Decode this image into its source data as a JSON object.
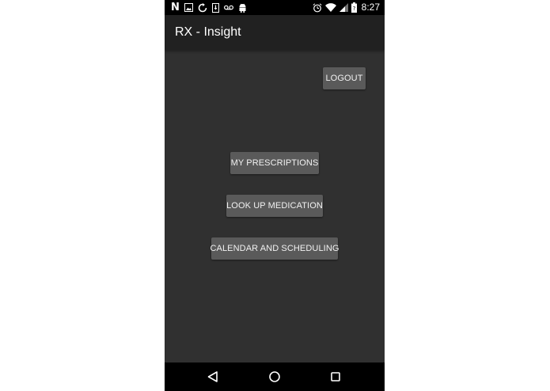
{
  "status_bar": {
    "time": "8:27",
    "left_icons": [
      "netflix-n-icon",
      "image-icon",
      "sync-icon",
      "download-icon",
      "voicemail-icon",
      "android-icon"
    ],
    "right_icons": [
      "alarm-icon",
      "wifi-icon",
      "signal-icon",
      "battery-icon"
    ]
  },
  "app_bar": {
    "title": "RX - Insight"
  },
  "buttons": {
    "logout": "LOGOUT",
    "my_prescriptions": "MY PRESCRIPTIONS",
    "look_up_medication": "LOOK UP MEDICATION",
    "calendar_and_scheduling": "CALENDAR AND SCHEDULING"
  },
  "nav_bar": {
    "icons": [
      "back-icon",
      "home-icon",
      "recents-icon"
    ]
  },
  "colors": {
    "background": "#303030",
    "app_bar": "#212121",
    "button": "#5a5a5a",
    "status_bar": "#000000"
  }
}
